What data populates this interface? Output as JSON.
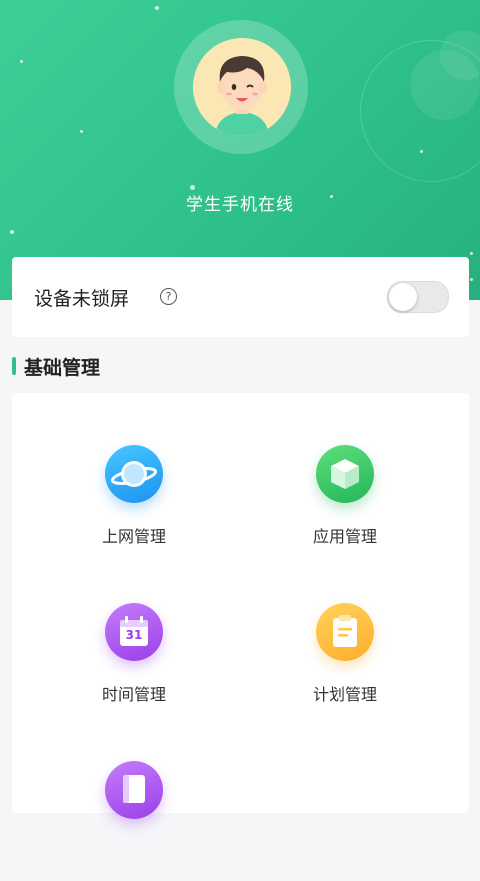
{
  "header": {
    "status_text": "学生手机在线"
  },
  "lock_setting": {
    "label": "设备未锁屏",
    "help_glyph": "?",
    "toggle_on": false
  },
  "section": {
    "title": "基础管理"
  },
  "grid": {
    "items": [
      {
        "label": "上网管理",
        "icon": "planet-icon"
      },
      {
        "label": "应用管理",
        "icon": "cube-icon"
      },
      {
        "label": "时间管理",
        "icon": "calendar-icon",
        "icon_text": "31"
      },
      {
        "label": "计划管理",
        "icon": "clipboard-icon"
      },
      {
        "label": "",
        "icon": "book-icon"
      }
    ]
  },
  "colors": {
    "header_green": "#2fc18a",
    "accent": "#2fc18a"
  }
}
